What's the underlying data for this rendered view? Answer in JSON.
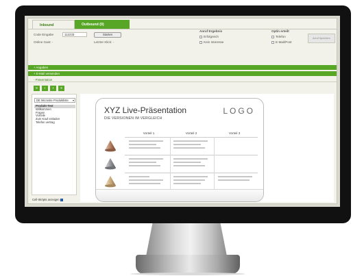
{
  "tabs": [
    {
      "label": "Inbound"
    },
    {
      "label": "Outbound (0)"
    }
  ],
  "search": {
    "code_label": "Code Eingabe",
    "code_value": "112233",
    "start_label": "Starten",
    "online_label": "Online Gast: -",
    "last_click_label": "Letzter Klick: -"
  },
  "call_result": {
    "title": "Anruf Ergebnis",
    "options": [
      "Erfolgreich",
      "Kein Interesse"
    ]
  },
  "optin": {
    "title": "Optin erteilt",
    "options": [
      "Telefon",
      "E-Mail/Post"
    ],
    "save_label": "Anruf Speichern"
  },
  "sections": {
    "angaben": "+ Angaben",
    "email": "+ E-Mail versenden",
    "presentation": "- Präsentation"
  },
  "nav_buttons": [
    "«",
    "‹",
    "›",
    "»"
  ],
  "sidebar": {
    "selected_presentation": "DE Microsite Produktliste",
    "items": [
      "Produkt-Test",
      "Willkommen",
      "Fragen",
      "Vorteile",
      "Zum Kauf einladen",
      "Telefon vertrag"
    ],
    "selected_index": 0
  },
  "cell_status": "Cell-Skripts anzeigen",
  "slide": {
    "title": "XYZ Live-Präsentation",
    "subtitle": "DIE VERSIONEN IM VERGLEICH",
    "logo": "LOGO",
    "columns": [
      "Vorteil 1",
      "Vorteil 2",
      "Vorteil 3"
    ],
    "colors": {
      "accent": "#58a626",
      "cone_bronze": "#b07a5a",
      "cone_silver": "#8e9095",
      "cone_gold": "#c9a878"
    }
  }
}
